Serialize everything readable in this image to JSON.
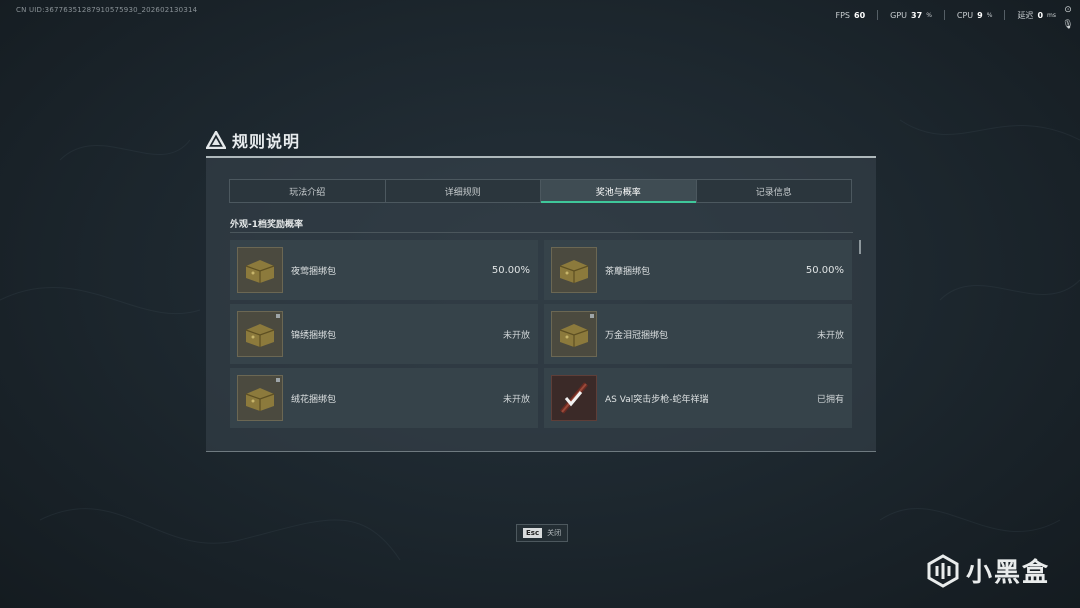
{
  "uid": "CN UID:36776351287910575930_202602130314",
  "stats": {
    "fps_label": "FPS",
    "fps_value": "60",
    "gpu_label": "GPU",
    "gpu_value": "37",
    "gpu_unit": "%",
    "cpu_label": "CPU",
    "cpu_value": "9",
    "cpu_unit": "%",
    "latency_label": "延迟",
    "latency_value": "0",
    "latency_unit": "ms"
  },
  "dialog": {
    "title": "规则说明",
    "tabs": [
      {
        "label": "玩法介绍",
        "active": false
      },
      {
        "label": "详细规则",
        "active": false
      },
      {
        "label": "奖池与概率",
        "active": true
      },
      {
        "label": "记录信息",
        "active": false
      }
    ],
    "section_label": "外观-1档奖励概率",
    "items": [
      {
        "name": "夜莺捆绑包",
        "value": "50.00%",
        "icon": "crate-icon"
      },
      {
        "name": "茶蘼捆绑包",
        "value": "50.00%",
        "icon": "crate-icon"
      },
      {
        "name": "锦绣捆绑包",
        "value": "未开放",
        "icon": "crate-icon"
      },
      {
        "name": "万金泪冠捆绑包",
        "value": "未开放",
        "icon": "crate-icon"
      },
      {
        "name": "绒花捆绑包",
        "value": "未开放",
        "icon": "crate-icon"
      },
      {
        "name": "AS Val突击步枪-蛇年祥瑞",
        "value": "已拥有",
        "icon": "rifle-icon"
      }
    ]
  },
  "esc": {
    "key": "Esc",
    "label": "关闭"
  },
  "watermark": {
    "text": "小黑盒"
  }
}
